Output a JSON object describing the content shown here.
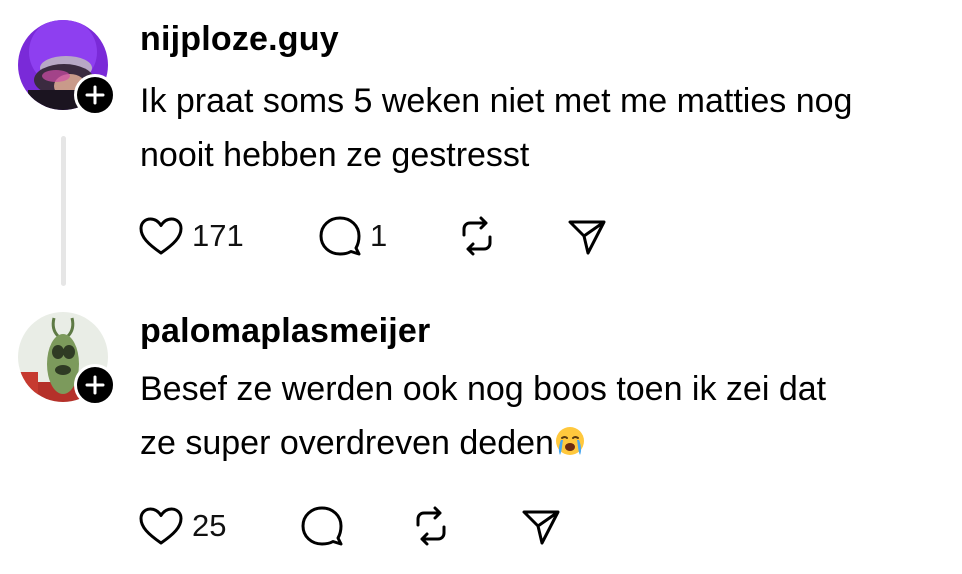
{
  "posts": [
    {
      "username": "nijploze.guy",
      "text_line1": "Ik praat soms 5 weken niet met me matties nog",
      "text_line2": "nooit hebben ze gestresst",
      "likes": "171",
      "replies": "1"
    },
    {
      "username": "palomaplasmeijer",
      "text_line1": "Besef ze werden ook nog boos toen ik zei dat",
      "text_line2": "ze super overdreven deden",
      "emoji": "crying-face",
      "likes": "25"
    }
  ],
  "icons": {
    "like": "heart-icon",
    "reply": "comment-bubble-icon",
    "repost": "repost-icon",
    "share": "send-icon",
    "follow": "plus-icon"
  }
}
